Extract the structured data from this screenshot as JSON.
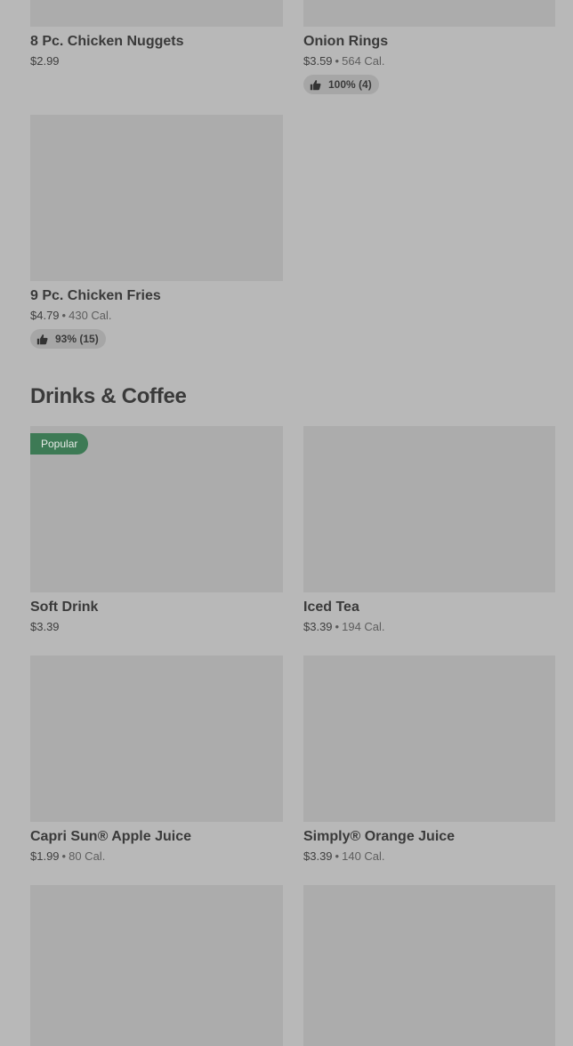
{
  "section": {
    "title": "Drinks & Coffee"
  },
  "items": [
    {
      "name": "8 Pc. Chicken Nuggets",
      "price": "$2.99"
    },
    {
      "name": "Onion Rings",
      "price": "$3.59",
      "calories": "564 Cal.",
      "rating": "100% (4)"
    },
    {
      "name": "9 Pc. Chicken Fries",
      "price": "$4.79",
      "calories": "430 Cal.",
      "rating": "93% (15)"
    },
    {
      "name": "Soft Drink",
      "price": "$3.39",
      "badge": "Popular"
    },
    {
      "name": "Iced Tea",
      "price": "$3.39",
      "calories": "194 Cal."
    },
    {
      "name": "Capri Sun® Apple Juice",
      "price": "$1.99",
      "calories": "80 Cal."
    },
    {
      "name": "Simply® Orange Juice",
      "price": "$3.39",
      "calories": "140 Cal."
    }
  ],
  "separator": "•",
  "icons": {
    "rating": "thumbs-up-icon"
  }
}
